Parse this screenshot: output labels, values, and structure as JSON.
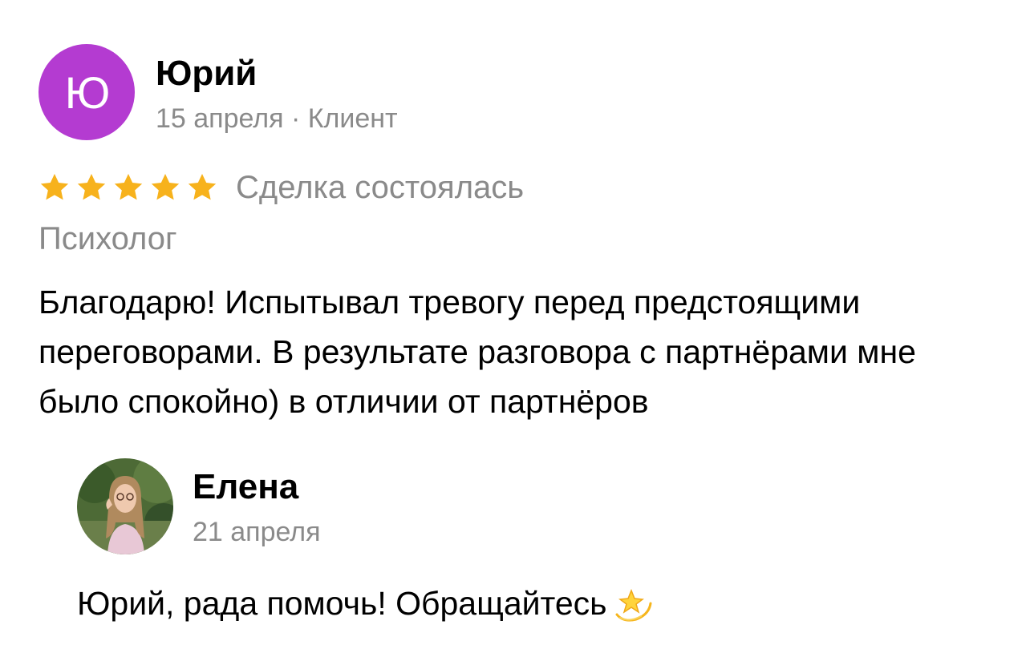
{
  "review": {
    "author": {
      "initial": "Ю",
      "name": "Юрий",
      "meta": "15 апреля · Клиент",
      "avatar_color": "#b43bd1"
    },
    "rating": {
      "stars": 5,
      "max": 5,
      "star_color": "#f7b21c"
    },
    "deal_status": "Сделка состоялась",
    "service": "Психолог",
    "text": "Благодарю! Испытывал тревогу перед предстоящими переговорами. В результате разговора с партнёрами мне было спокойно) в отличии от партнёров"
  },
  "reply": {
    "name": "Елена",
    "date": "21 апреля",
    "text": "Юрий, рада помочь! Обращайтесь",
    "emoji_icon": "dizzy-star-icon"
  }
}
